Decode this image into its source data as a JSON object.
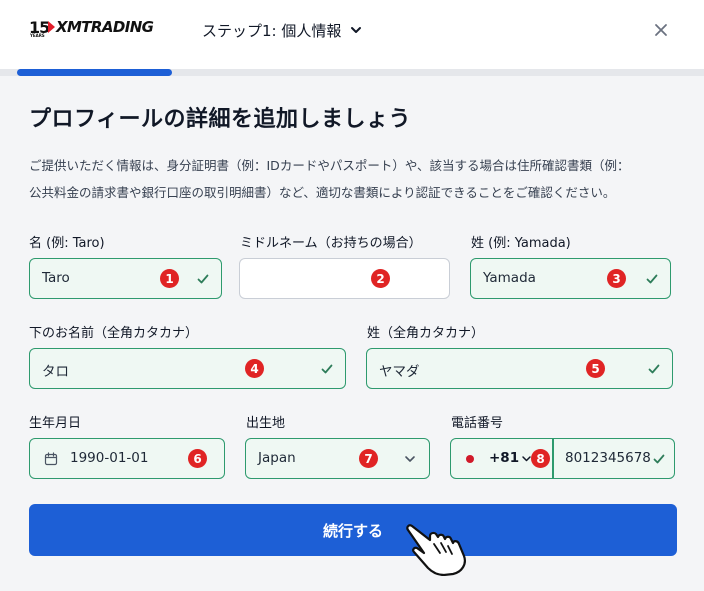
{
  "header": {
    "logo_years": "15",
    "logo_years_caption": "YEARS",
    "logo_brand": "XMTRADING",
    "step_label": "ステップ1: 個人情報",
    "step_icon": "chevron-down-icon",
    "close_icon": "close-icon",
    "progress_fraction": 0.22
  },
  "main": {
    "title": "プロフィールの詳細を追加しましょう",
    "description_line1": "ご提供いただく情報は、身分証明書（例：IDカードやパスポート）や、該当する場合は住所確認書類（例：",
    "description_line2": "公共料金の請求書や銀行口座の取引明細書）など、適切な書類により認証できることをご確認ください。"
  },
  "fields": {
    "first_name": {
      "label": "名 (例: Taro)",
      "value": "Taro",
      "badge": "1"
    },
    "middle_name": {
      "label": "ミドルネーム（お持ちの場合）",
      "value": "",
      "badge": "2"
    },
    "last_name": {
      "label": "姓 (例: Yamada)",
      "value": "Yamada",
      "badge": "3"
    },
    "first_name_kana": {
      "label": "下のお名前（全角カタカナ）",
      "value": "タロ",
      "badge": "4"
    },
    "last_name_kana": {
      "label": "姓（全角カタカナ）",
      "value": "ヤマダ",
      "badge": "5"
    },
    "birth_date": {
      "label": "生年月日",
      "value": "1990-01-01",
      "badge": "6"
    },
    "birth_place": {
      "label": "出生地",
      "value": "Japan",
      "badge": "7"
    },
    "phone": {
      "label": "電話番号",
      "country_code": "+81",
      "number": "8012345678",
      "badge": "8"
    }
  },
  "actions": {
    "submit_label": "続行する"
  },
  "colors": {
    "accent": "#1d5fd6",
    "valid_border": "#2e9a6e",
    "valid_bg": "#eff8f3",
    "badge": "#e02424"
  }
}
